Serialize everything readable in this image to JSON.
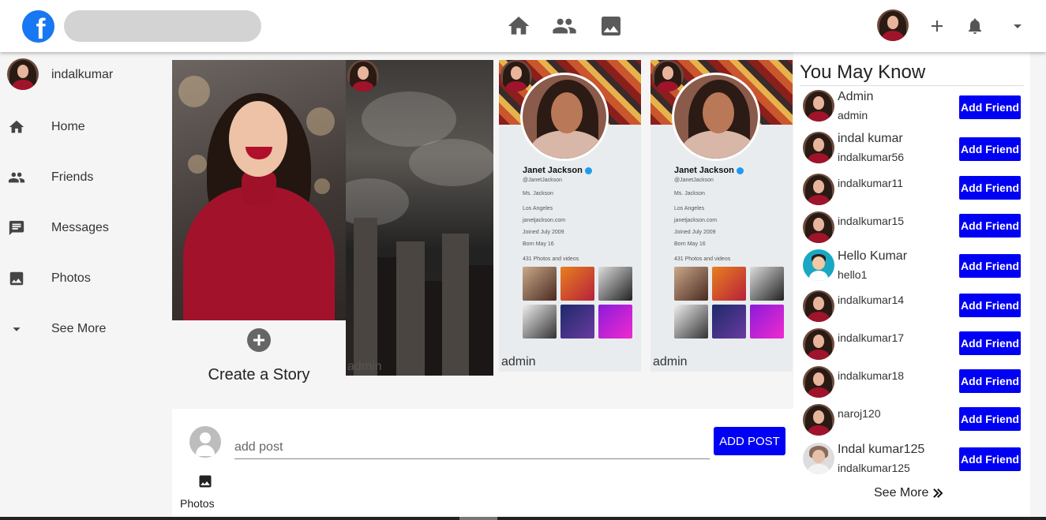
{
  "header": {
    "logo_letter": "f",
    "search": {
      "value": "",
      "placeholder": ""
    },
    "nav_icons": [
      "home-icon",
      "friends-icon",
      "photos-icon"
    ],
    "actions": [
      "avatar",
      "plus-icon",
      "bell-icon",
      "dropdown-icon"
    ]
  },
  "sidebar": {
    "profile_name": "indalkumar",
    "items": [
      {
        "label": "Home",
        "icon": "home-icon"
      },
      {
        "label": "Friends",
        "icon": "friends-icon"
      },
      {
        "label": "Messages",
        "icon": "messages-icon"
      },
      {
        "label": "Photos",
        "icon": "photos-icon"
      },
      {
        "label": "See More",
        "icon": "caret-down-icon"
      }
    ]
  },
  "stories": {
    "create_label": "Create a Story",
    "items": [
      {
        "caption": "admin"
      },
      {
        "caption": "admin",
        "profile_name": "Janet Jackson",
        "handle": "@JanetJackson",
        "bio": "Ms. Jackson",
        "location": "Los Angeles",
        "website": "janetjackson.com",
        "joined": "Joined July 2009",
        "born": "Born May 16",
        "media": "431 Photos and videos"
      },
      {
        "caption": "admin",
        "profile_name": "Janet Jackson",
        "handle": "@JanetJackson",
        "bio": "Ms. Jackson",
        "location": "Los Angeles",
        "website": "janetjackson.com",
        "joined": "Joined July 2009",
        "born": "Born May 16",
        "media": "431 Photos and videos"
      }
    ]
  },
  "post": {
    "placeholder": "add post",
    "value": "",
    "button_label": "ADD POST",
    "photos_label": "Photos"
  },
  "you_may_know": {
    "title": "You May Know",
    "button_label": "Add Friend",
    "see_more": "See More",
    "friends": [
      {
        "name": "Admin",
        "username": "admin"
      },
      {
        "name": "indal kumar",
        "username": "indalkumar56"
      },
      {
        "name": "",
        "username": "indalkumar11"
      },
      {
        "name": "",
        "username": "indalkumar15"
      },
      {
        "name": "Hello Kumar",
        "username": "hello1"
      },
      {
        "name": "",
        "username": "indalkumar14"
      },
      {
        "name": "",
        "username": "indalkumar17"
      },
      {
        "name": "",
        "username": "indalkumar18"
      },
      {
        "name": "",
        "username": "naroj120"
      },
      {
        "name": "Indal kumar125",
        "username": "indalkumar125"
      }
    ]
  },
  "colors": {
    "brand": "#1877f2",
    "button": "#0000f5"
  }
}
